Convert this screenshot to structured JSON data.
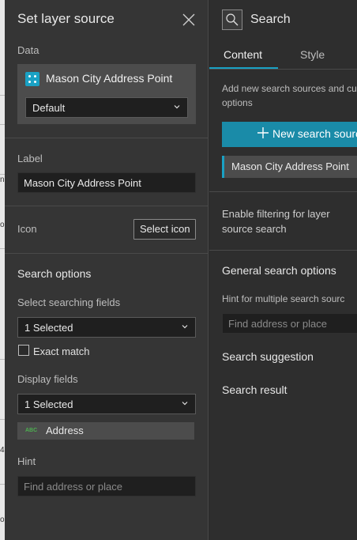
{
  "background_fragments": [
    "n",
    "ol",
    "4",
    "ol"
  ],
  "layer_panel": {
    "title": "Set layer source",
    "data_label": "Data",
    "data_source_name": "Mason City Address Point",
    "data_view_value": "Default",
    "label_label": "Label",
    "label_value": "Mason City Address Point",
    "icon_label": "Icon",
    "select_icon_button": "Select icon",
    "search_options_title": "Search options",
    "searching_fields_label": "Select searching fields",
    "searching_fields_value": "1 Selected",
    "exact_match_label": "Exact match",
    "display_fields_label": "Display fields",
    "display_fields_value": "1 Selected",
    "display_field_chip": {
      "type_badge": "ABC",
      "name": "Address"
    },
    "hint_label": "Hint",
    "hint_placeholder": "Find address or place"
  },
  "search_panel": {
    "title": "Search",
    "tabs": [
      {
        "label": "Content",
        "active": true
      },
      {
        "label": "Style",
        "active": false
      }
    ],
    "description_line1": "Add new search sources and cu",
    "description_line2": "options",
    "new_source_button": "New search sourc",
    "source_items": [
      "Mason City Address Point"
    ],
    "enable_filtering_line1": "Enable filtering for layer",
    "enable_filtering_line2": "source search",
    "general_options_title": "General search options",
    "hint_multiple_label": "Hint for multiple search sourc",
    "hint_multiple_placeholder": "Find address or place",
    "search_suggestion_title": "Search suggestion",
    "search_result_title": "Search result"
  },
  "colors": {
    "accent": "#1aa1c4",
    "primary_button": "#1a8ba8",
    "panel_bg": "#353535",
    "input_bg": "#1f1f1f",
    "field_type_green": "#4caf50"
  },
  "icons": {
    "close": "close-icon",
    "data_source": "feature-layer-icon",
    "chevron": "chevron-down-icon",
    "search_widget": "search-widget-icon",
    "add": "plus-icon",
    "field_type": "string-field-icon"
  }
}
